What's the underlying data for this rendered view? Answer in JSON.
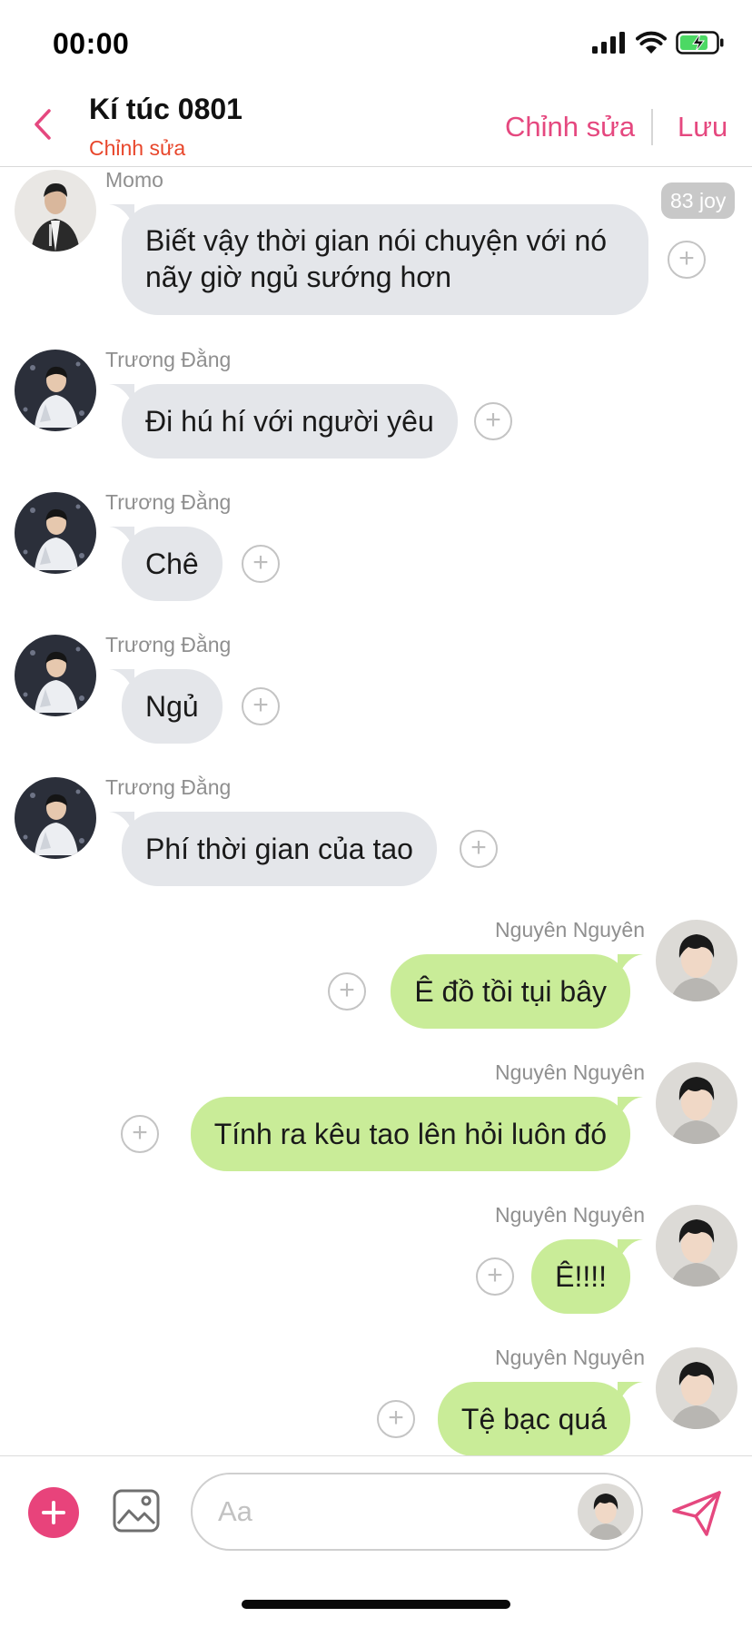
{
  "status_bar": {
    "time": "00:00"
  },
  "header": {
    "title": "Kí túc 0801",
    "subtitle": "Chỉnh sửa",
    "edit_label": "Chỉnh sửa",
    "save_label": "Lưu"
  },
  "messages": [
    {
      "sender": "Momo",
      "side": "left",
      "lines": [
        "Biết vậy thời gian nói chuyện với nó",
        "nãy giờ ngủ sướng hơn"
      ],
      "badge": "83 joy"
    },
    {
      "sender": "Trương Đằng",
      "side": "left",
      "text": "Đi hú hí với người yêu"
    },
    {
      "sender": "Trương Đằng",
      "side": "left",
      "text": "Chê"
    },
    {
      "sender": "Trương Đằng",
      "side": "left",
      "text": "Ngủ"
    },
    {
      "sender": "Trương Đằng",
      "side": "left",
      "text": "Phí thời gian của tao"
    },
    {
      "sender": "Nguyên Nguyên",
      "side": "right",
      "text": "Ê đồ tồi tụi bây"
    },
    {
      "sender": "Nguyên Nguyên",
      "side": "right",
      "text": "Tính ra kêu tao lên hỏi luôn đó"
    },
    {
      "sender": "Nguyên Nguyên",
      "side": "right",
      "text": "Ê!!!!"
    },
    {
      "sender": "Nguyên Nguyên",
      "side": "right",
      "text": "Tệ bạc quá"
    }
  ],
  "input": {
    "placeholder": "Aa"
  },
  "icons": {
    "back": "chevron-left-icon",
    "plus": "plus-icon",
    "image": "image-icon",
    "send": "send-icon",
    "react": "add-reaction-icon"
  },
  "colors": {
    "accent": "#e5487f",
    "subtitle_red": "#e8462b",
    "bubble_left": "#e4e6ea",
    "bubble_right": "#c9ec98",
    "battery_green": "#4cd964"
  }
}
